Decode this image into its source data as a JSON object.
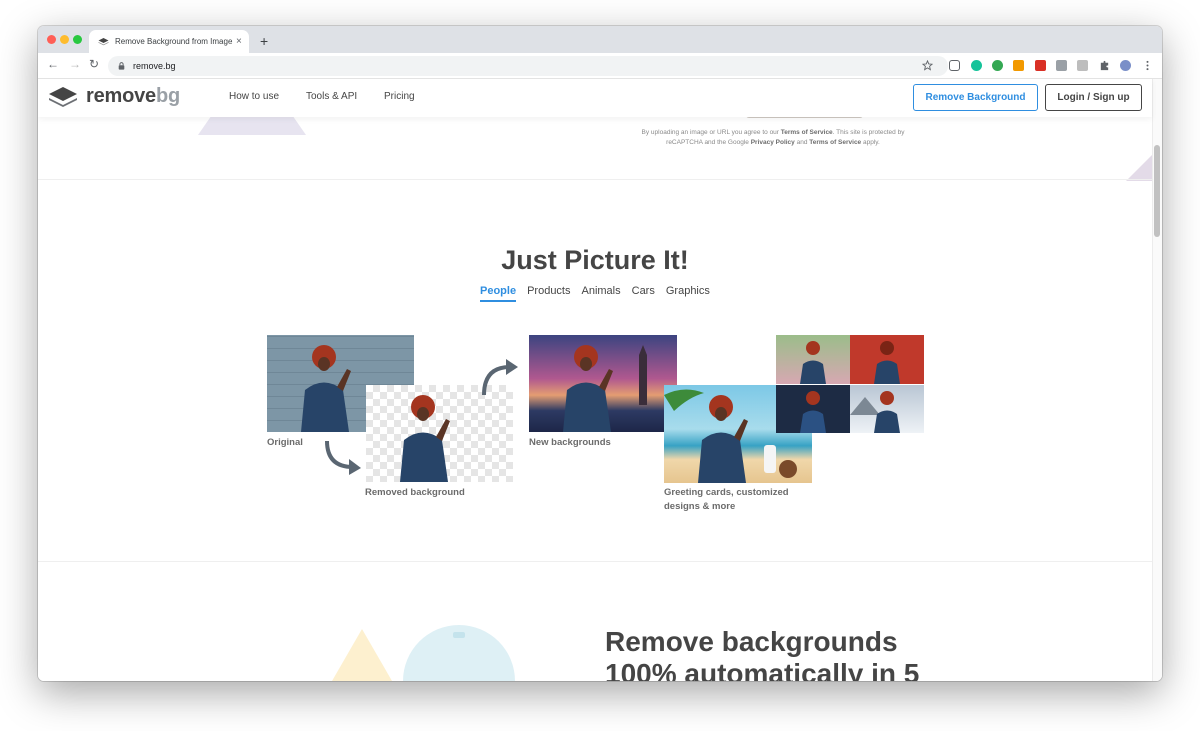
{
  "browser": {
    "tab_title": "Remove Background from Image",
    "new_tab_glyph": "+",
    "close_glyph": "×",
    "url": "remove.bg",
    "nav": {
      "back": "←",
      "forward": "→",
      "reload": "↻"
    },
    "icons": [
      "star-icon",
      "pocket-icon",
      "grammarly-icon",
      "extension-green-icon",
      "extension-orange-icon",
      "extension-red-icon",
      "extension-gray-icon",
      "extension-k-icon",
      "puzzle-icon",
      "profile-avatar",
      "kebab-menu-icon"
    ]
  },
  "header": {
    "logo_word": "remove",
    "logo_suffix": "bg",
    "menu": [
      "How to use",
      "Tools & API",
      "Pricing"
    ],
    "cta_primary": "Remove Background",
    "cta_secondary": "Login / Sign up"
  },
  "disclaimer": {
    "p1": "By uploading an image or URL you agree to our ",
    "tos": "Terms of Service",
    "p2": ". This site is protected by reCAPTCHA and the Google ",
    "privacy": "Privacy Policy",
    "p3": " and ",
    "tos2": "Terms of Service",
    "p4": " apply."
  },
  "showcase": {
    "title": "Just Picture It!",
    "tabs": [
      "People",
      "Products",
      "Animals",
      "Cars",
      "Graphics"
    ],
    "active_tab": "People",
    "captions": {
      "original": "Original",
      "removed": "Removed background",
      "new_bg": "New backgrounds",
      "greeting_l1": "Greeting cards, customized",
      "greeting_l2": "designs & more"
    }
  },
  "next_section": {
    "line1": "Remove backgrounds",
    "line2": "100% automatically in 5"
  },
  "colors": {
    "accent": "#2f8ee0",
    "text": "#454545",
    "lavender": "#e7e4f0"
  }
}
